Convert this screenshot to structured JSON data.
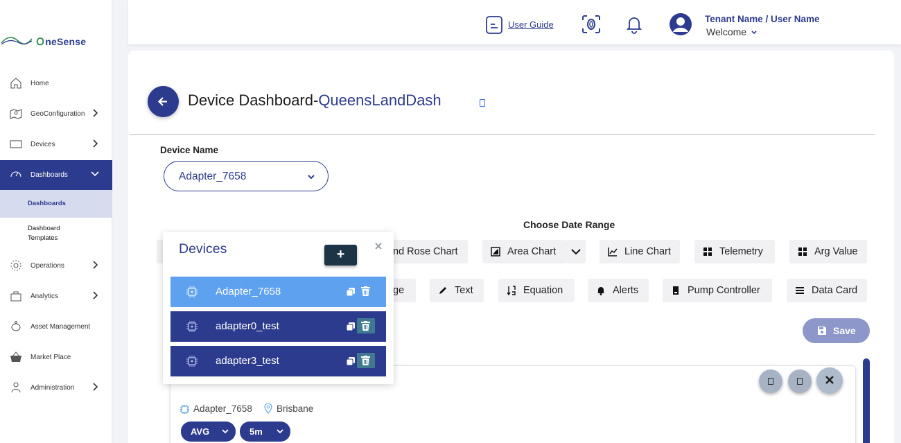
{
  "brand": {
    "name": "OneSense",
    "name_rest": "neSense"
  },
  "sidebar": {
    "items": [
      {
        "label": "Home"
      },
      {
        "label": "GeoConfiguration"
      },
      {
        "label": "Devices"
      },
      {
        "label": "Dashboards"
      },
      {
        "label": "Operations"
      },
      {
        "label": "Analytics"
      },
      {
        "label": "Asset Management"
      },
      {
        "label": "Market Place"
      },
      {
        "label": "Administration"
      }
    ],
    "sub_items": [
      {
        "label": "Dashboards"
      },
      {
        "label": "Dashboard",
        "label2": "Templates"
      }
    ]
  },
  "header": {
    "user_guide": "User Guide",
    "tenant": "Tenant Name / User Name",
    "welcome": "Welcome"
  },
  "page": {
    "title_prefix": "Device Dashboard-",
    "dashboard_name": "QueensLandDash",
    "device_name_label": "Device Name",
    "device_selected": "Adapter_7658",
    "date_range_label": "Choose Date Range"
  },
  "widgets": [
    {
      "label": "nd Rose Chart"
    },
    {
      "label": "Area Chart"
    },
    {
      "label": "Line Chart"
    },
    {
      "label": "Telemetry"
    },
    {
      "label": "Arg Value"
    },
    {
      "label": "ge"
    },
    {
      "label": "Text"
    },
    {
      "label": "Equation"
    },
    {
      "label": "Alerts"
    },
    {
      "label": "Pump Controller"
    },
    {
      "label": "Data Card"
    }
  ],
  "save_label": "Save",
  "card": {
    "device": "Adapter_7658",
    "location": "Brisbane",
    "agg": "AVG",
    "interval": "5m"
  },
  "popup": {
    "title": "Devices",
    "add": "+",
    "devices": [
      {
        "name": "Adapter_7658"
      },
      {
        "name": "adapter0_test"
      },
      {
        "name": "adapter3_test"
      }
    ]
  },
  "colors": {
    "primary": "#2d3b8e",
    "selected_row": "#5ea1ef",
    "save": "#8d97c9"
  }
}
